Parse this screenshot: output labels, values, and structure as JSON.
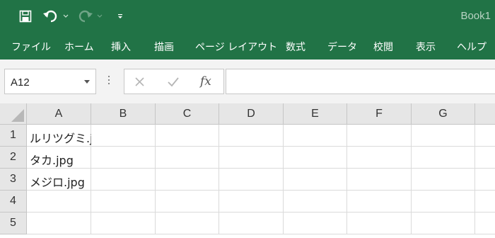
{
  "app": {
    "title": "Book1",
    "colors": {
      "brand": "#217346",
      "header_bg": "#e6e6e6",
      "gridline": "#dadada"
    }
  },
  "quick_access": {
    "icons": [
      "save-icon",
      "undo-icon",
      "redo-icon",
      "customize-qat-icon"
    ]
  },
  "ribbon": {
    "tabs": [
      {
        "label": "ファイル"
      },
      {
        "label": "ホーム"
      },
      {
        "label": "挿入"
      },
      {
        "label": "描画"
      },
      {
        "label": "ページ レイアウト"
      },
      {
        "label": "数式"
      },
      {
        "label": "データ"
      },
      {
        "label": "校閲"
      },
      {
        "label": "表示"
      },
      {
        "label": "ヘルプ"
      }
    ]
  },
  "formula_bar": {
    "name_box": "A12",
    "fx_symbol": "fx",
    "formula_value": ""
  },
  "sheet": {
    "columns": [
      "A",
      "B",
      "C",
      "D",
      "E",
      "F",
      "G"
    ],
    "rows": [
      {
        "num": "1",
        "cells": [
          "ルリツグミ.jpg",
          "",
          "",
          "",
          "",
          "",
          ""
        ]
      },
      {
        "num": "2",
        "cells": [
          "タカ.jpg",
          "",
          "",
          "",
          "",
          "",
          ""
        ]
      },
      {
        "num": "3",
        "cells": [
          "メジロ.jpg",
          "",
          "",
          "",
          "",
          "",
          ""
        ]
      },
      {
        "num": "4",
        "cells": [
          "",
          "",
          "",
          "",
          "",
          "",
          ""
        ]
      },
      {
        "num": "5",
        "cells": [
          "",
          "",
          "",
          "",
          "",
          "",
          ""
        ]
      }
    ]
  }
}
